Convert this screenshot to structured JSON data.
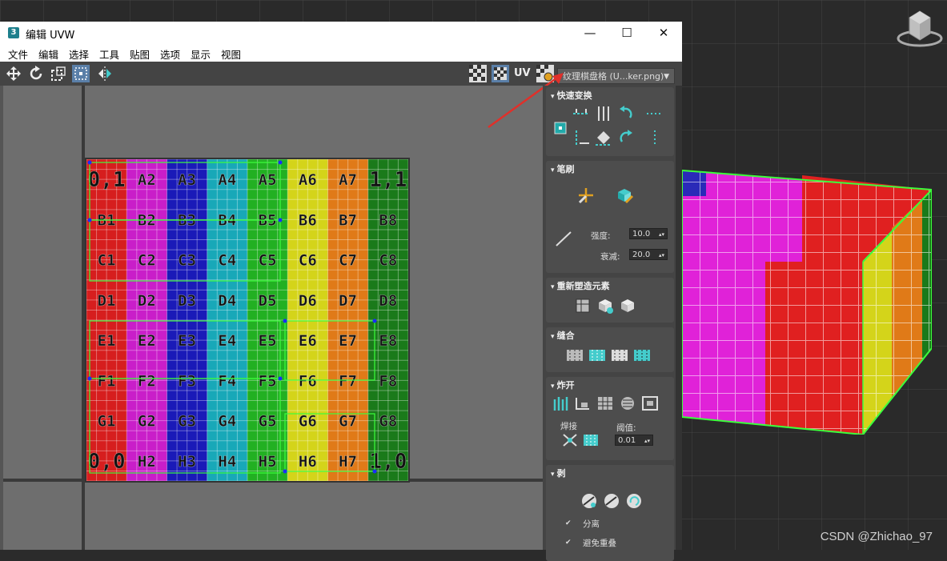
{
  "window": {
    "title": "编辑 UVW",
    "app_badge": "3",
    "minimize": "—",
    "maximize": "☐",
    "close": "✕"
  },
  "menu": [
    "文件",
    "编辑",
    "选择",
    "工具",
    "贴图",
    "选项",
    "显示",
    "视图"
  ],
  "toolbar": {
    "left_icons": [
      "move-icon",
      "rotate-icon",
      "scale-icon",
      "freeform-icon",
      "mirror-icon"
    ],
    "right_icons": [
      "checker-pattern-icon",
      "checker-pattern-alt-icon",
      "uv-icon",
      "texture-settings-icon"
    ],
    "uv_label": "UV",
    "texture_dropdown": "纹理棋盘格 (U...ker.png)"
  },
  "checker": {
    "rows": [
      [
        "0,1",
        "A2",
        "A3",
        "A4",
        "A5",
        "A6",
        "A7",
        "1,1"
      ],
      [
        "B1",
        "B2",
        "B3",
        "B4",
        "B5",
        "B6",
        "B7",
        "B8"
      ],
      [
        "C1",
        "C2",
        "C3",
        "C4",
        "C5",
        "C6",
        "C7",
        "C8"
      ],
      [
        "D1",
        "D2",
        "D3",
        "D4",
        "D5",
        "D6",
        "D7",
        "D8"
      ],
      [
        "E1",
        "E2",
        "E3",
        "E4",
        "E5",
        "E6",
        "E7",
        "E8"
      ],
      [
        "F1",
        "F2",
        "F3",
        "F4",
        "F5",
        "F6",
        "F7",
        "F8"
      ],
      [
        "G1",
        "G2",
        "G3",
        "G4",
        "G5",
        "G6",
        "G7",
        "G8"
      ],
      [
        "0,0",
        "H2",
        "H3",
        "H4",
        "H5",
        "H6",
        "H7",
        "1,0"
      ]
    ],
    "column_colors": [
      "#d61e1e",
      "#c91ec9",
      "#1a1ab8",
      "#18a8b8",
      "#22b022",
      "#d4d41a",
      "#e07a18",
      "#1a7a1a"
    ]
  },
  "panel": {
    "quick_transform": {
      "title": "快速变换"
    },
    "brush": {
      "title": "笔刷",
      "strength_label": "强度:",
      "strength_value": "10.0",
      "falloff_label": "衰减:",
      "falloff_value": "20.0"
    },
    "reshape": {
      "title": "重新塑造元素"
    },
    "stitch": {
      "title": "缝合"
    },
    "explode": {
      "title": "炸开",
      "weld_label": "焊接",
      "threshold_label": "阈值:",
      "threshold_value": "0.01"
    },
    "peel": {
      "title": "剥",
      "detach_label": "分离",
      "avoid_overlap_label": "避免重叠"
    }
  },
  "watermark": "CSDN @Zhichao_97"
}
